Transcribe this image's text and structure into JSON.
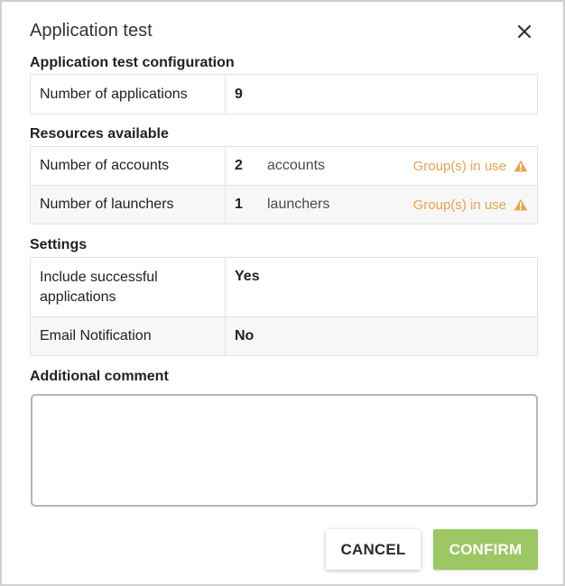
{
  "dialog": {
    "title": "Application test"
  },
  "config": {
    "section_title": "Application test configuration",
    "rows": [
      {
        "label": "Number of applications",
        "value": "9"
      }
    ]
  },
  "resources": {
    "section_title": "Resources available",
    "rows": [
      {
        "label": "Number of accounts",
        "count": "2",
        "unit": "accounts",
        "warning": "Group(s) in use"
      },
      {
        "label": "Number of launchers",
        "count": "1",
        "unit": "launchers",
        "warning": "Group(s) in use"
      }
    ],
    "warning_color": "#e8a34a"
  },
  "settings": {
    "section_title": "Settings",
    "rows": [
      {
        "label": "Include successful applications",
        "value": "Yes"
      },
      {
        "label": "Email Notification",
        "value": "No"
      }
    ]
  },
  "comment": {
    "label": "Additional comment",
    "value": ""
  },
  "buttons": {
    "cancel": "CANCEL",
    "confirm": "CONFIRM"
  },
  "colors": {
    "confirm_bg": "#9dc763"
  }
}
